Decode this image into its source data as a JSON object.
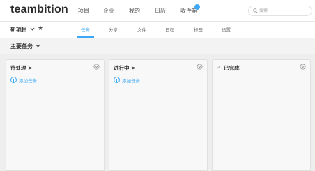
{
  "app": {
    "logo": "teambition"
  },
  "nav": {
    "items": [
      {
        "label": "项目"
      },
      {
        "label": "企业"
      },
      {
        "label": "我的"
      },
      {
        "label": "日历"
      },
      {
        "label": "收件箱"
      }
    ]
  },
  "search": {
    "placeholder": "搜索"
  },
  "project": {
    "name": "新项目"
  },
  "tabs": [
    {
      "label": "任务",
      "active": true
    },
    {
      "label": "分享"
    },
    {
      "label": "文件"
    },
    {
      "label": "日程"
    },
    {
      "label": "标签"
    },
    {
      "label": "设置"
    }
  ],
  "filter": {
    "label": "主要任务"
  },
  "columns": [
    {
      "title": "待处理 >",
      "add_label": "添加任务"
    },
    {
      "title": "进行中 >",
      "add_label": "添加任务"
    },
    {
      "title": "已完成"
    }
  ],
  "colors": {
    "accent": "#3da8f5"
  }
}
